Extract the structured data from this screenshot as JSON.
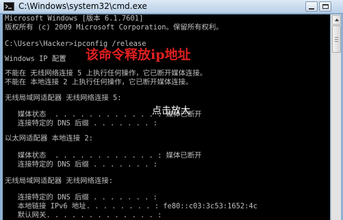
{
  "window": {
    "title": "C:\\Windows\\system32\\cmd.exe"
  },
  "console": {
    "lines": [
      "Microsoft Windows [版本 6.1.7601]",
      "版权所有 (c) 2009 Microsoft Corporation。保留所有权利。",
      "C:\\Users\\Hacker>ipconfig /release",
      "Windows IP 配置",
      "不能在 无线网络连接 5 上执行任何操作，它已断开媒体连接。",
      "不能在 本地连接 2 上执行任何操作，它已断开媒体连接。",
      "无线局域网适配器 无线网络连接 5:",
      "   媒体状态  . . . . . . . . . . . . : 媒体已断开",
      "   连接特定的 DNS 后缀 . . . . . . . :",
      "以太网适配器 本地连接 2:",
      "   媒体状态  . . . . . . . . . . . . : 媒体已断开",
      "   连接特定的 DNS 后缀 . . . . . . . :",
      "无线局域网适配器 无线网络连接:",
      "   连接特定的 DNS 后缀 . . . . . . . :",
      "   本地链接 IPv6 地址. . . . . . . . : fe80::c03:3c53:1652:4c",
      "   默认网关. . . . . . . . . . . . . :"
    ]
  },
  "overlays": {
    "annotation": "该命令释放ip地址",
    "zoom_hint": "点击放大"
  },
  "colors": {
    "console_bg": "#000000",
    "console_text": "#c0c0c0",
    "annotation": "#e02020"
  },
  "icons": {
    "app": "cmd-icon",
    "minimize": "minimize-icon",
    "maximize": "maximize-icon"
  }
}
